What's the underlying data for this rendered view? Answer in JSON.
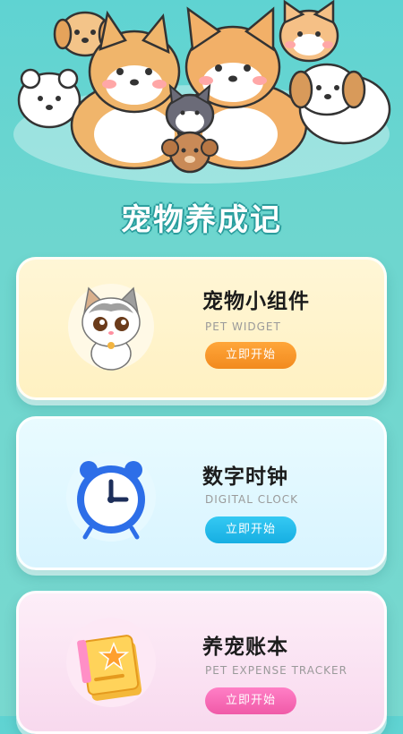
{
  "app": {
    "title": "宠物养成记"
  },
  "hero": {
    "illustration_icon": "dog-group-illustration"
  },
  "cards": [
    {
      "title": "宠物小组件",
      "subtitle": "PET WIDGET",
      "button_label": "立即开始",
      "icon": "cat-icon",
      "accent": "#f28a1e"
    },
    {
      "title": "数字时钟",
      "subtitle": "DIGITAL CLOCK",
      "button_label": "立即开始",
      "icon": "alarm-clock-icon",
      "accent": "#17aee2"
    },
    {
      "title": "养宠账本",
      "subtitle": "PET EXPENSE TRACKER",
      "button_label": "立即开始",
      "icon": "notebook-icon",
      "accent": "#f05aa8"
    }
  ]
}
